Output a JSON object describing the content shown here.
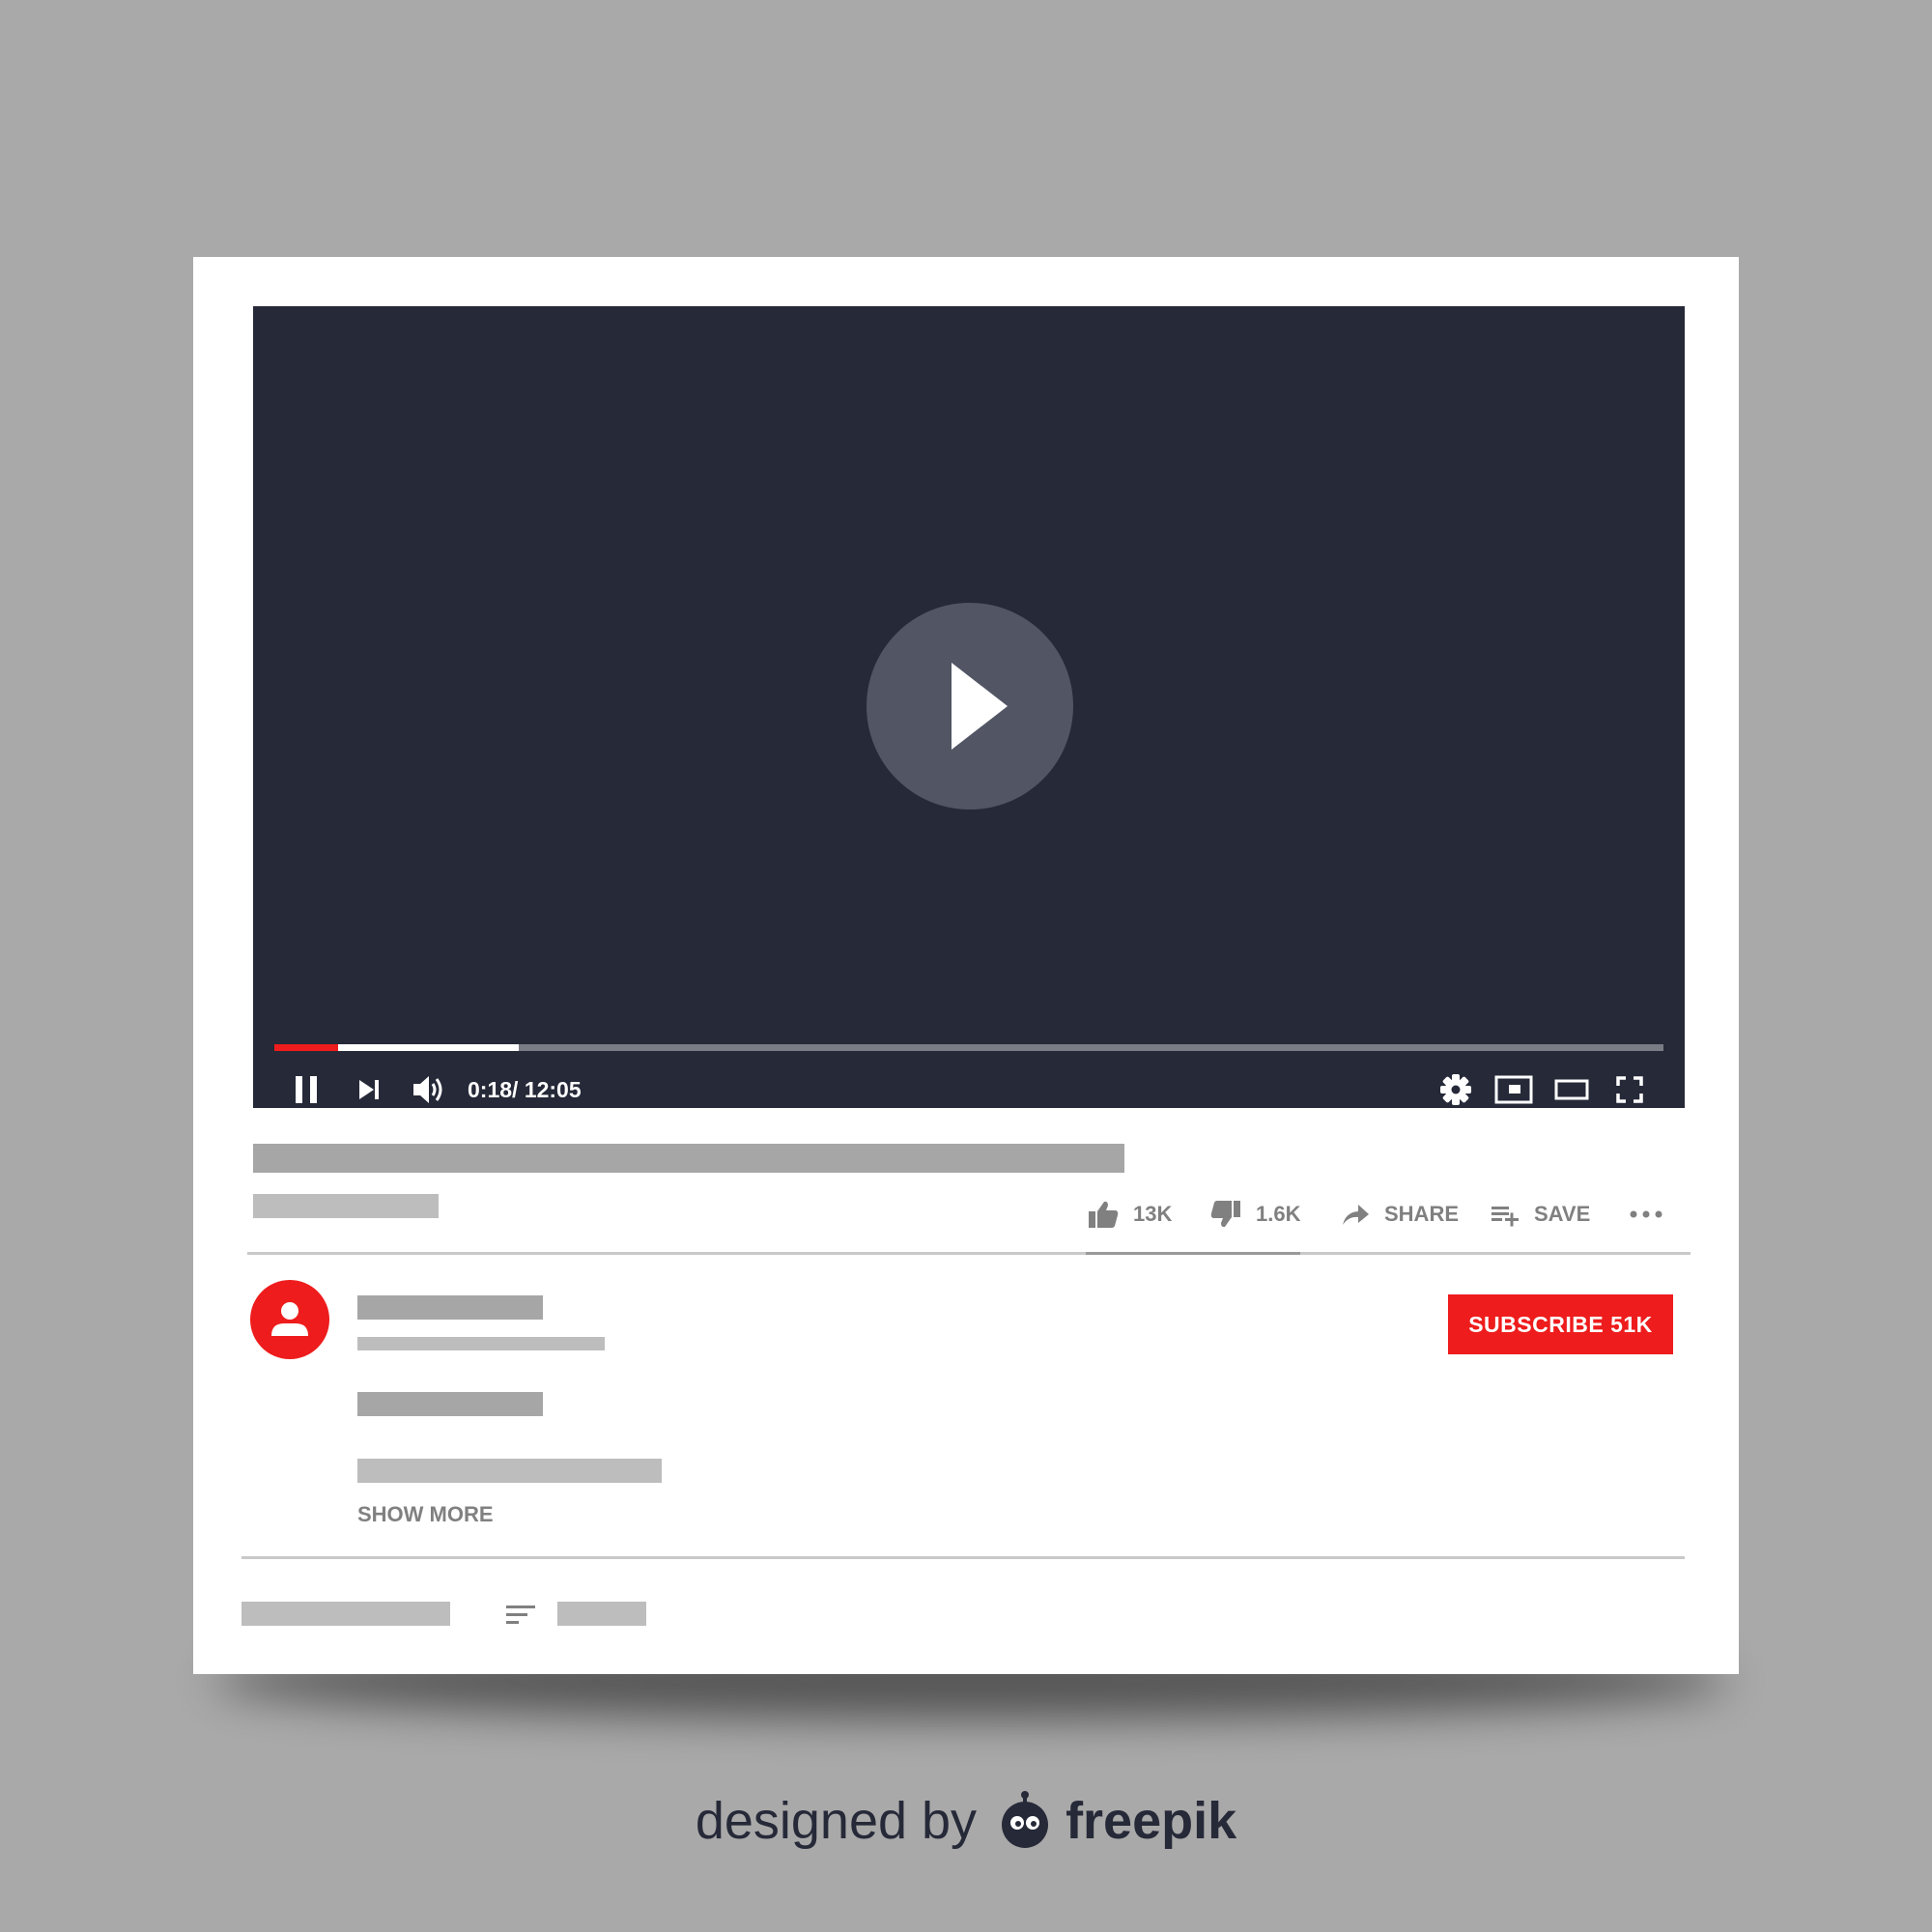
{
  "player": {
    "progress": {
      "played_fraction": 0.046,
      "buffered_fraction": 0.176
    },
    "controls": {
      "pause_icon": "pause-icon",
      "next_icon": "skip-next-icon",
      "volume_icon": "volume-icon",
      "settings_icon": "gear-icon",
      "miniplayer_icon": "miniplayer-icon",
      "theater_icon": "theater-mode-icon",
      "fullscreen_icon": "fullscreen-icon"
    },
    "time_display": "0:18/ 12:05",
    "center_icon": "play-icon"
  },
  "actions": {
    "likes": "13K",
    "dislikes": "1.6K",
    "share_label": "SHARE",
    "save_label": "SAVE",
    "more_icon": "more-horizontal-icon"
  },
  "channel": {
    "avatar_icon": "user-icon",
    "subscribe_label": "SUBSCRIBE 51K",
    "show_more_label": "SHOW MORE"
  },
  "comments": {
    "sort_icon": "sort-icon"
  },
  "credit": {
    "prefix": "designed by",
    "brand": "freepik"
  },
  "colors": {
    "background": "#a9a9a9",
    "player": "#262938",
    "accent_red": "#ee1c1c",
    "placeholder_dark": "#a6a6a6",
    "placeholder_light": "#bdbdbd",
    "text_gray": "#808080"
  }
}
